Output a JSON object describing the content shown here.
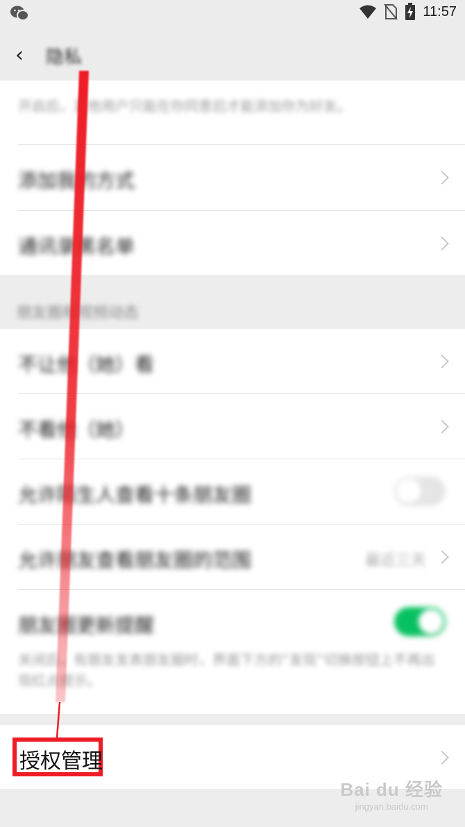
{
  "status_bar": {
    "time": "11:57",
    "icons": [
      "wechat-icon",
      "wifi-icon",
      "no-sim-icon",
      "battery-charging-icon"
    ]
  },
  "nav": {
    "back_icon": "chevron-left-icon",
    "title": "隐私"
  },
  "section1": {
    "partial_row_subtitle": "开启后，其他用户只能在你同意后才能添加你为好友。",
    "rows": [
      {
        "label": "添加我的方式"
      },
      {
        "label": "通讯录黑名单"
      }
    ]
  },
  "section2": {
    "header": "朋友圈和视频动态",
    "rows": [
      {
        "label": "不让他（她）看"
      },
      {
        "label": "不看他（她）"
      },
      {
        "label": "允许陌生人查看十条朋友圈",
        "toggle": false
      },
      {
        "label": "允许朋友查看朋友圈的范围",
        "value": "最近三天"
      },
      {
        "label": "朋友圈更新提醒",
        "toggle": true,
        "subtitle": "关闭后，有朋友发表朋友圈时，界面下方的“发现”切换按钮上不再出现红点提示。"
      }
    ]
  },
  "section3": {
    "rows": [
      {
        "label": "授权管理"
      }
    ]
  },
  "annotation": {
    "color": "#ee1c25"
  },
  "watermark": {
    "logo": "Bai du 经验",
    "url": "jingyan.baidu.com"
  }
}
